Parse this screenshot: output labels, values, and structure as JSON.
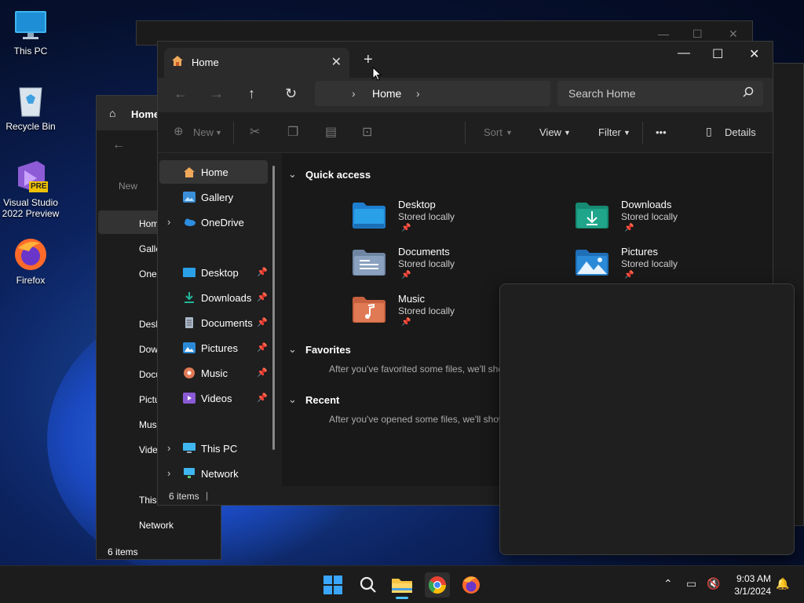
{
  "desktop": {
    "icons": [
      {
        "label": "This PC"
      },
      {
        "label": "Recycle Bin"
      },
      {
        "label": "Visual Studio 2022 Preview",
        "badge": "PRE"
      },
      {
        "label": "Firefox"
      }
    ]
  },
  "back_window": {
    "tab_title": "Home",
    "new_label": "New",
    "nav_items": [
      "Home",
      "Gallery",
      "OneDrive",
      "Desktop",
      "Downloads",
      "Documents",
      "Pictures",
      "Music",
      "Videos",
      "This PC",
      "Network"
    ],
    "status": "6 items"
  },
  "explorer": {
    "tab_title": "Home",
    "window_controls": {
      "minimize": "—",
      "maximize": "☐",
      "close": "✕"
    },
    "breadcrumb": {
      "current": "Home"
    },
    "search": {
      "placeholder": "Search Home"
    },
    "commands": {
      "new": "New",
      "sort": "Sort",
      "view": "View",
      "filter": "Filter",
      "more": "•••",
      "details": "Details"
    },
    "sidebar": [
      {
        "label": "Home",
        "selected": true
      },
      {
        "label": "Gallery"
      },
      {
        "label": "OneDrive",
        "expandable": true
      },
      {
        "label": "Desktop",
        "pinned": true
      },
      {
        "label": "Downloads",
        "pinned": true
      },
      {
        "label": "Documents",
        "pinned": true
      },
      {
        "label": "Pictures",
        "pinned": true
      },
      {
        "label": "Music",
        "pinned": true
      },
      {
        "label": "Videos",
        "pinned": true
      },
      {
        "label": "This PC",
        "expandable": true
      },
      {
        "label": "Network",
        "expandable": true
      }
    ],
    "sections": {
      "quick_access": "Quick access",
      "favorites": "Favorites",
      "favorites_hint": "After you've favorited some files, we'll sho",
      "recent": "Recent",
      "recent_hint": "After you've opened some files, we'll show"
    },
    "quick_access": [
      {
        "name": "Desktop",
        "sub": "Stored locally"
      },
      {
        "name": "Downloads",
        "sub": "Stored locally"
      },
      {
        "name": "Documents",
        "sub": "Stored locally"
      },
      {
        "name": "Pictures",
        "sub": "Stored locally"
      },
      {
        "name": "Music",
        "sub": "Stored locally"
      }
    ],
    "status": "6 items"
  },
  "taskbar": {
    "time": "9:03 AM",
    "date": "3/1/2024"
  },
  "colors": {
    "accent": "#4cc2ff",
    "desktop_folder": "#2aa0e8",
    "downloads_folder": "#1fa58a",
    "documents_folder": "#8aa1bf",
    "pictures_folder": "#2b8ad8",
    "music_folder": "#e07a55",
    "chrome_active": "#ffc83d"
  }
}
